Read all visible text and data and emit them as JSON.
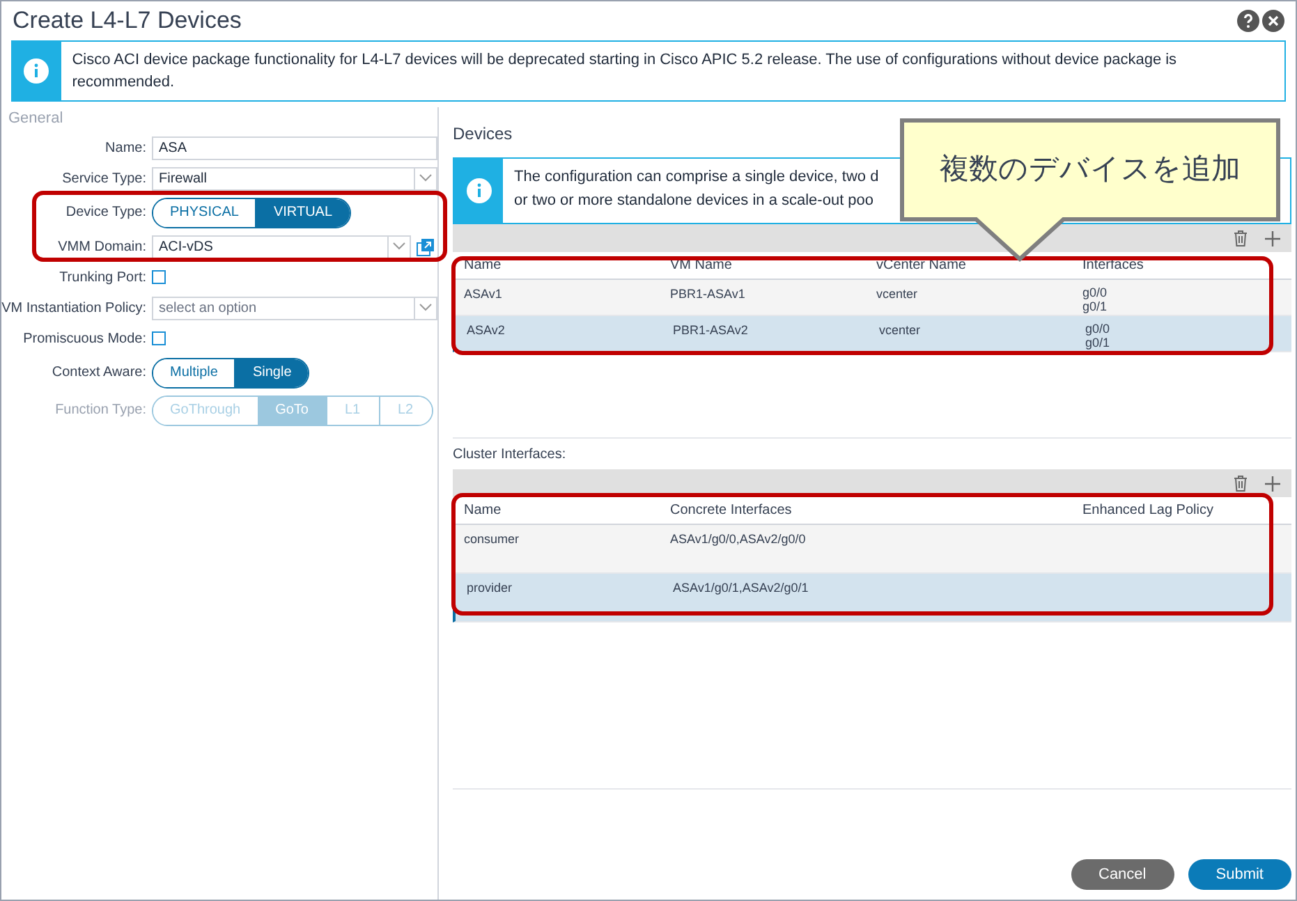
{
  "window": {
    "title": "Create L4-L7 Devices"
  },
  "banner": {
    "text": "Cisco ACI device package functionality for L4-L7 devices will be deprecated starting in Cisco APIC 5.2 release. The use of configurations without device package is recommended."
  },
  "general": {
    "heading": "General",
    "fields": [
      {
        "kind": "text",
        "label": "Name:",
        "value": "ASA"
      },
      {
        "kind": "select",
        "label": "Service Type:",
        "value": "Firewall"
      },
      {
        "kind": "segmented",
        "label": "Device Type:",
        "disabled": false,
        "options": [
          {
            "label": "PHYSICAL",
            "selected": false
          },
          {
            "label": "VIRTUAL",
            "selected": true
          }
        ]
      },
      {
        "kind": "select",
        "label": "VMM Domain:",
        "value": "ACI-vDS",
        "link": true
      },
      {
        "kind": "checkbox",
        "label": "Trunking Port:",
        "checked": false
      },
      {
        "kind": "select",
        "label": "VM Instantiation Policy:",
        "placeholder": "select an option"
      },
      {
        "kind": "checkbox",
        "label": "Promiscuous Mode:",
        "checked": false
      },
      {
        "kind": "segmented",
        "label": "Context Aware:",
        "disabled": false,
        "options": [
          {
            "label": "Multiple",
            "selected": false
          },
          {
            "label": "Single",
            "selected": true
          }
        ]
      },
      {
        "kind": "segmented",
        "label": "Function Type:",
        "disabled": true,
        "options": [
          {
            "label": "GoThrough",
            "selected": false
          },
          {
            "label": "GoTo",
            "selected": true
          },
          {
            "label": "L1",
            "selected": false
          },
          {
            "label": "L2",
            "selected": false
          }
        ]
      }
    ]
  },
  "devices": {
    "heading": "Devices",
    "info": [
      "The configuration can comprise a single device, two d",
      "or two or more standalone devices in a scale-out poo"
    ],
    "columns": [
      "Name",
      "VM Name",
      "vCenter Name",
      "Interfaces"
    ],
    "rows": [
      {
        "selected": false,
        "cells": [
          "ASAv1",
          "PBR1-ASAv1",
          "vcenter"
        ],
        "interfaces": [
          "g0/0",
          "g0/1"
        ]
      },
      {
        "selected": true,
        "cells": [
          "ASAv2",
          "PBR1-ASAv2",
          "vcenter"
        ],
        "interfaces": [
          "g0/0",
          "g0/1"
        ]
      }
    ]
  },
  "cluster": {
    "heading": "Cluster Interfaces:",
    "columns": [
      "Name",
      "Concrete Interfaces",
      "Enhanced Lag Policy"
    ],
    "rows": [
      {
        "selected": false,
        "cells": [
          "consumer",
          "ASAv1/g0/0,ASAv2/g0/0",
          ""
        ]
      },
      {
        "selected": true,
        "cells": [
          "provider",
          "ASAv1/g0/1,ASAv2/g0/1",
          ""
        ]
      }
    ]
  },
  "callout": {
    "text": "複数のデバイスを追加"
  },
  "buttons": [
    "Cancel",
    "Submit"
  ]
}
